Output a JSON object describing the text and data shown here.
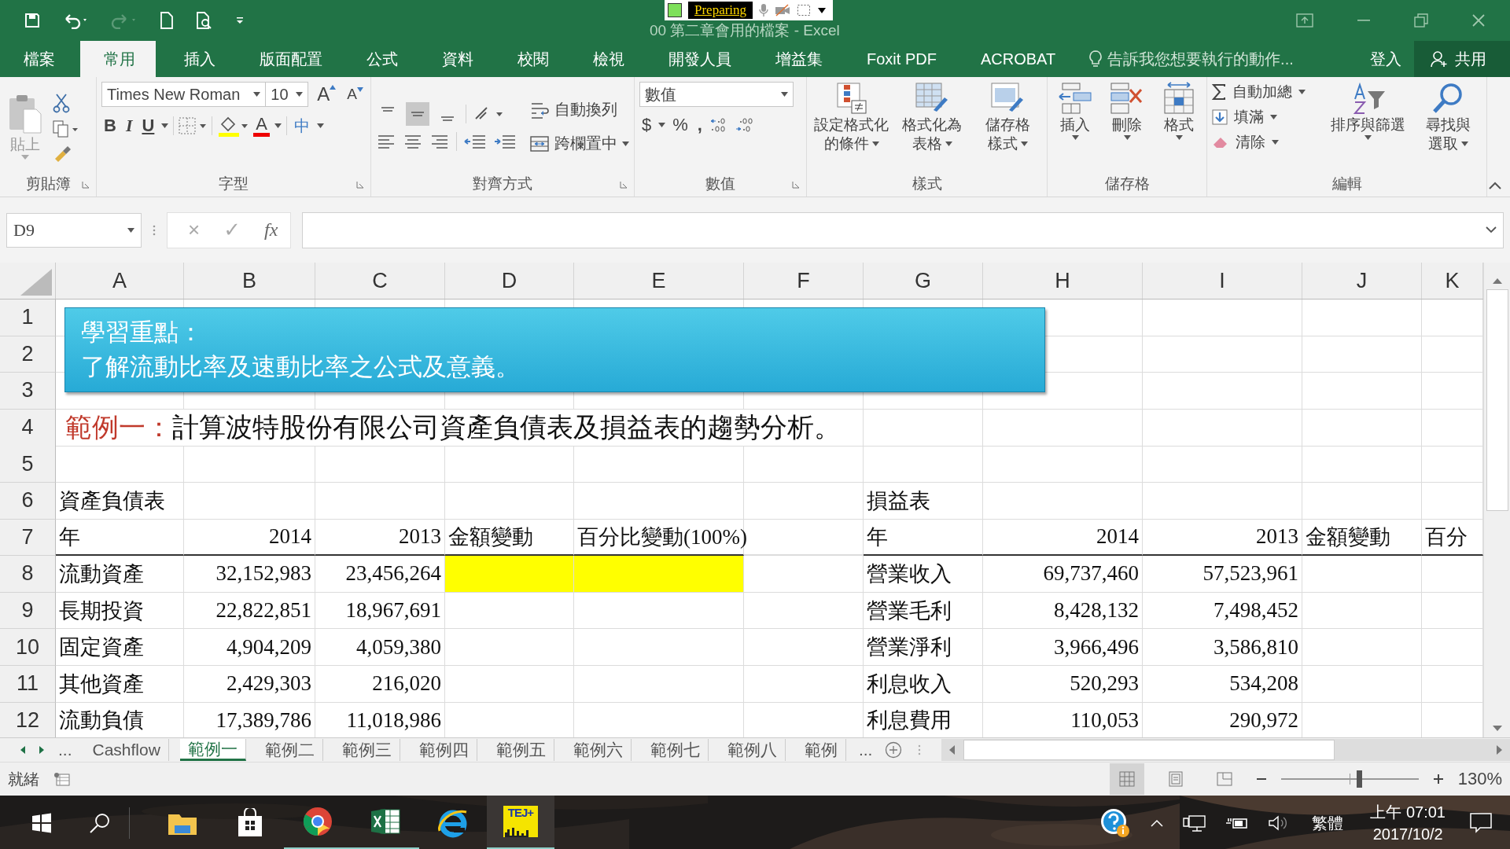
{
  "title_bar": {
    "title": "00 第二章會用的檔案 - Excel",
    "quick_access": [
      {
        "kind": "save",
        "disabled": false
      },
      {
        "kind": "undo",
        "disabled": false
      },
      {
        "kind": "redo",
        "disabled": true
      },
      {
        "kind": "new",
        "disabled": false
      },
      {
        "kind": "preview",
        "disabled": false
      },
      {
        "kind": "customize",
        "disabled": false
      }
    ]
  },
  "recorder": {
    "status": "Preparing"
  },
  "ribbon_tabs": [
    {
      "label": "檔案",
      "selected": false
    },
    {
      "label": "常用",
      "selected": true
    },
    {
      "label": "插入",
      "selected": false
    },
    {
      "label": "版面配置",
      "selected": false
    },
    {
      "label": "公式",
      "selected": false
    },
    {
      "label": "資料",
      "selected": false
    },
    {
      "label": "校閱",
      "selected": false
    },
    {
      "label": "檢視",
      "selected": false
    },
    {
      "label": "開發人員",
      "selected": false
    },
    {
      "label": "增益集",
      "selected": false
    },
    {
      "label": "Foxit PDF",
      "selected": false
    },
    {
      "label": "ACROBAT",
      "selected": false
    }
  ],
  "tell_me": {
    "placeholder": "告訴我您想要執行的動作..."
  },
  "sign_in": "登入",
  "share": "共用",
  "ribbon": {
    "clipboard": {
      "paste": "貼上",
      "label": "剪貼簿"
    },
    "font": {
      "family": "Times New Roman",
      "size": "10",
      "grow": "A",
      "shrink": "A",
      "bold": "B",
      "italic": "I",
      "underline": "U",
      "font_color": "A",
      "phonetic": "中",
      "label": "字型"
    },
    "alignment": {
      "vertical": [
        {
          "selected": false
        },
        {
          "selected": true
        },
        {
          "selected": false
        }
      ],
      "wrap": "自動換列",
      "merge": "跨欄置中",
      "label": "對齊方式"
    },
    "number": {
      "format": "數值",
      "currency": "$",
      "percent": "%",
      "comma": ",",
      "label": "數值"
    },
    "styles": {
      "items": [
        {
          "lines": [
            "設定格式化",
            "的條件"
          ]
        },
        {
          "lines": [
            "格式化為",
            "表格"
          ]
        },
        {
          "lines": [
            "儲存格",
            "樣式"
          ]
        }
      ],
      "label": "樣式"
    },
    "cells": {
      "items": [
        {
          "kind": "insert",
          "label": "插入"
        },
        {
          "kind": "delete",
          "label": "刪除"
        },
        {
          "kind": "format",
          "label": "格式"
        }
      ],
      "label": "儲存格"
    },
    "editing": {
      "autosum": "自動加總",
      "fill": "填滿",
      "clear": "清除",
      "sort": [
        "排序與篩選"
      ],
      "find": [
        "尋找與",
        "選取"
      ],
      "label": "編輯"
    }
  },
  "formula_bar": {
    "name_box": "D9",
    "cancel": "×",
    "enter": "✓",
    "fx": "fx"
  },
  "sheet": {
    "columns": [
      "A",
      "B",
      "C",
      "D",
      "E",
      "F",
      "G",
      "H",
      "I",
      "J",
      "K"
    ],
    "banner": {
      "lines": [
        "學習重點：",
        "了解流動比率及速動比率之公式及意義。"
      ]
    },
    "rows": [
      {
        "number": "1",
        "bottom_border": false
      },
      {
        "number": "2",
        "bottom_border": false
      },
      {
        "number": "3",
        "bottom_border": false
      },
      {
        "number": "4",
        "bottom_border": false,
        "heading": {
          "label": "範例一：",
          "text": "計算波特股份有限公司資產負債表及損益表的趨勢分析。"
        }
      },
      {
        "number": "5",
        "bottom_border": false
      },
      {
        "number": "6",
        "bottom_border": false,
        "cells": {
          "A": "資產負債表",
          "G": "損益表"
        }
      },
      {
        "number": "7",
        "bottom_border": true,
        "cells": {
          "A": "年",
          "B": "2014",
          "C": "2013",
          "D": "金額變動",
          "E": "百分比變動(100%)",
          "G": "年",
          "H": "2014",
          "I": "2013",
          "J": "金額變動",
          "K": "百分"
        }
      },
      {
        "number": "8",
        "bottom_border": false,
        "fills": {
          "D": true,
          "E": true
        },
        "cells": {
          "A": "流動資產",
          "B": "32,152,983",
          "C": "23,456,264",
          "G": "營業收入",
          "H": "69,737,460",
          "I": "57,523,961"
        }
      },
      {
        "number": "9",
        "bottom_border": false,
        "cells": {
          "A": "長期投資",
          "B": "22,822,851",
          "C": "18,967,691",
          "G": "營業毛利",
          "H": "8,428,132",
          "I": "7,498,452"
        }
      },
      {
        "number": "10",
        "bottom_border": false,
        "cells": {
          "A": "固定資產",
          "B": "4,904,209",
          "C": "4,059,380",
          "G": "營業淨利",
          "H": "3,966,496",
          "I": "3,586,810"
        }
      },
      {
        "number": "11",
        "bottom_border": false,
        "cells": {
          "A": "其他資產",
          "B": "2,429,303",
          "C": "216,020",
          "G": "利息收入",
          "H": "520,293",
          "I": "534,208"
        }
      },
      {
        "number": "12",
        "bottom_border": false,
        "cells": {
          "A": "流動負債",
          "B": "17,389,786",
          "C": "11,018,986",
          "G": "利息費用",
          "H": "110,053",
          "I": "290,972"
        }
      }
    ]
  },
  "sheet_tabs": [
    {
      "label": "Cashflow",
      "selected": false
    },
    {
      "label": "範例一",
      "selected": true
    },
    {
      "label": "範例二",
      "selected": false
    },
    {
      "label": "範例三",
      "selected": false
    },
    {
      "label": "範例四",
      "selected": false
    },
    {
      "label": "範例五",
      "selected": false
    },
    {
      "label": "範例六",
      "selected": false
    },
    {
      "label": "範例七",
      "selected": false
    },
    {
      "label": "範例八",
      "selected": false
    },
    {
      "label": "範例",
      "selected": false
    }
  ],
  "tab_more": "...",
  "status_bar": {
    "status": "就緒",
    "views": [
      {
        "kind": "normal",
        "selected": true
      },
      {
        "kind": "page_layout",
        "selected": false
      },
      {
        "kind": "page_break",
        "selected": false
      }
    ],
    "zoom_slider": {
      "level": 0.55
    },
    "zoom": "130%"
  },
  "taskbar": {
    "apps": [
      {
        "kind": "explorer",
        "running": false
      },
      {
        "kind": "store",
        "running": false
      },
      {
        "kind": "chrome",
        "running": true
      },
      {
        "kind": "excel",
        "running": true
      },
      {
        "kind": "ie",
        "running": false
      },
      {
        "kind": "tej",
        "label": "TEJ+",
        "running": true
      }
    ],
    "ime": "繁體",
    "time": "上午 07:01",
    "date": "2017/10/2"
  }
}
